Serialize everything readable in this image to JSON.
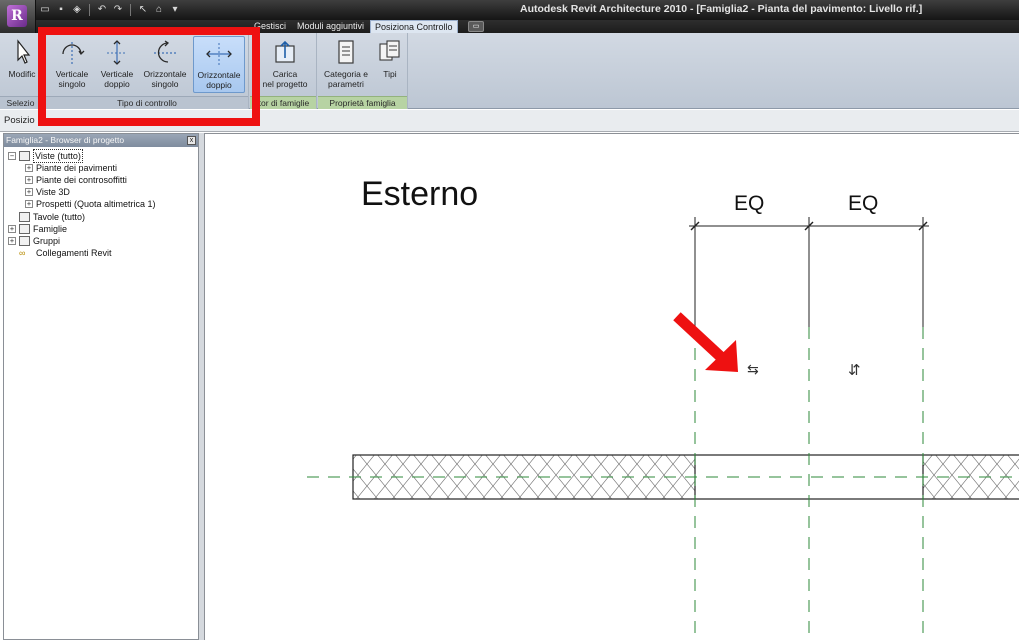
{
  "window": {
    "title": "Autodesk Revit Architecture 2010 - [Famiglia2 - Pianta del pavimento: Livello rif.]"
  },
  "app_button": {
    "label": "R"
  },
  "ribbon_tabs": [
    {
      "label": "Gestisci",
      "active": false
    },
    {
      "label": "Moduli aggiuntivi",
      "active": false
    },
    {
      "label": "Posiziona Controllo",
      "active": true
    }
  ],
  "ribbon": {
    "panels": {
      "selection": {
        "label": "Selezio",
        "buttons": [
          {
            "label": "Modific",
            "icon": "cursor-arrow-icon"
          }
        ]
      },
      "control_type": {
        "label": "Tipo di controllo",
        "buttons": [
          {
            "line1": "Verticale",
            "line2": "singolo",
            "icon": "vertical-single-flip-icon",
            "selected": false
          },
          {
            "line1": "Verticale",
            "line2": "doppio",
            "icon": "vertical-double-flip-icon",
            "selected": false
          },
          {
            "line1": "Orizzontale",
            "line2": "singolo",
            "icon": "horizontal-single-flip-icon",
            "selected": false
          },
          {
            "line1": "Orizzontale",
            "line2": "doppio",
            "icon": "horizontal-double-flip-icon",
            "selected": true
          }
        ]
      },
      "family_editor": {
        "label": "itor di famiglie",
        "buttons": [
          {
            "line1": "Carica",
            "line2": "nel progetto",
            "icon": "load-into-project-icon"
          }
        ]
      },
      "family_properties": {
        "label": "Proprietà famiglia",
        "buttons": [
          {
            "line1": "Categoria e",
            "line2": "parametri",
            "icon": "category-parameters-icon"
          },
          {
            "line1": "Tipi",
            "line2": "",
            "icon": "types-icon"
          }
        ]
      }
    }
  },
  "options_bar": {
    "label": "Posizio"
  },
  "project_browser": {
    "title": "Famiglia2 - Browser di progetto",
    "close_label": "x",
    "tree": [
      {
        "label": "Viste (tutto)",
        "level": 0,
        "expander": "-",
        "selected": true,
        "icon": "views-icon"
      },
      {
        "label": "Piante dei pavimenti",
        "level": 1,
        "expander": "+",
        "selected": false,
        "icon": ""
      },
      {
        "label": "Piante dei controsoffitti",
        "level": 1,
        "expander": "+",
        "selected": false,
        "icon": ""
      },
      {
        "label": "Viste 3D",
        "level": 1,
        "expander": "+",
        "selected": false,
        "icon": ""
      },
      {
        "label": "Prospetti (Quota altimetrica 1)",
        "level": 1,
        "expander": "+",
        "selected": false,
        "icon": ""
      },
      {
        "label": "Tavole (tutto)",
        "level": 0,
        "expander": "",
        "selected": false,
        "icon": "sheets-icon"
      },
      {
        "label": "Famiglie",
        "level": 0,
        "expander": "+",
        "selected": false,
        "icon": "families-icon"
      },
      {
        "label": "Gruppi",
        "level": 0,
        "expander": "+",
        "selected": false,
        "icon": "groups-icon"
      },
      {
        "label": "Collegamenti Revit",
        "level": 0,
        "expander": "",
        "selected": false,
        "icon": "revit-links-icon"
      }
    ]
  },
  "drawing": {
    "label_exterior": "Esterno",
    "dim_label_left": "EQ",
    "dim_label_right": "EQ",
    "flip_control_horizontal": "⇆",
    "flip_control_vertical": "⇵",
    "annotation_color": "#ee1111",
    "reference_line_color": "#2e8a3a",
    "highlight_color": "#ee1111"
  }
}
